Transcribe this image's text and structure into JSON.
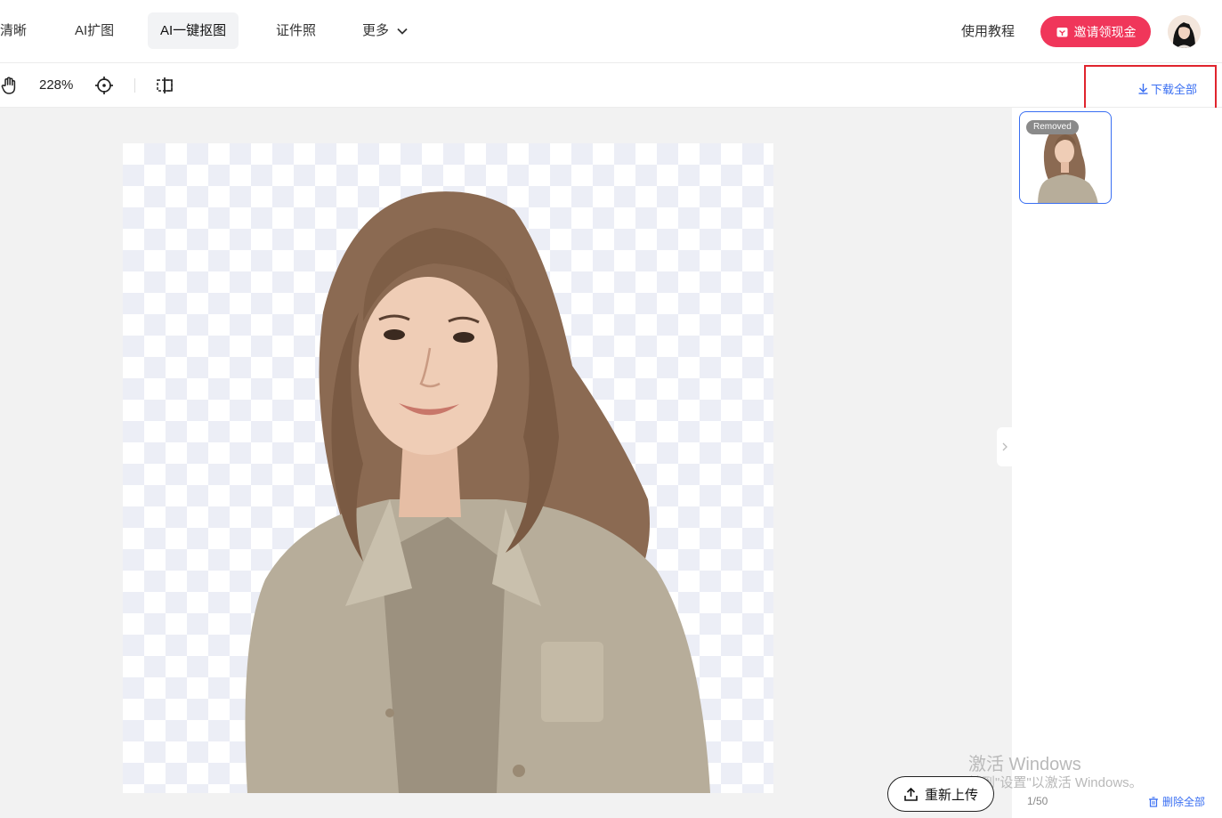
{
  "nav": {
    "items": [
      {
        "label": "清晰"
      },
      {
        "label": "AI扩图"
      },
      {
        "label": "AI一键抠图"
      },
      {
        "label": "证件照"
      },
      {
        "label": "更多"
      }
    ],
    "tutorial": "使用教程",
    "invite": "邀请领现金"
  },
  "toolbar": {
    "zoom": "228%",
    "download_all": "下载全部"
  },
  "side_panel": {
    "thumb_badge": "Removed",
    "counter": "1/50",
    "delete_all": "删除全部"
  },
  "canvas": {
    "reupload": "重新上传"
  },
  "watermark": {
    "line1": "激活 Windows",
    "line2": "转到\"设置\"以激活 Windows。"
  },
  "colors": {
    "accent": "#3a6ff2",
    "invite_bg": "#f0365a",
    "highlight": "#e0242d"
  }
}
